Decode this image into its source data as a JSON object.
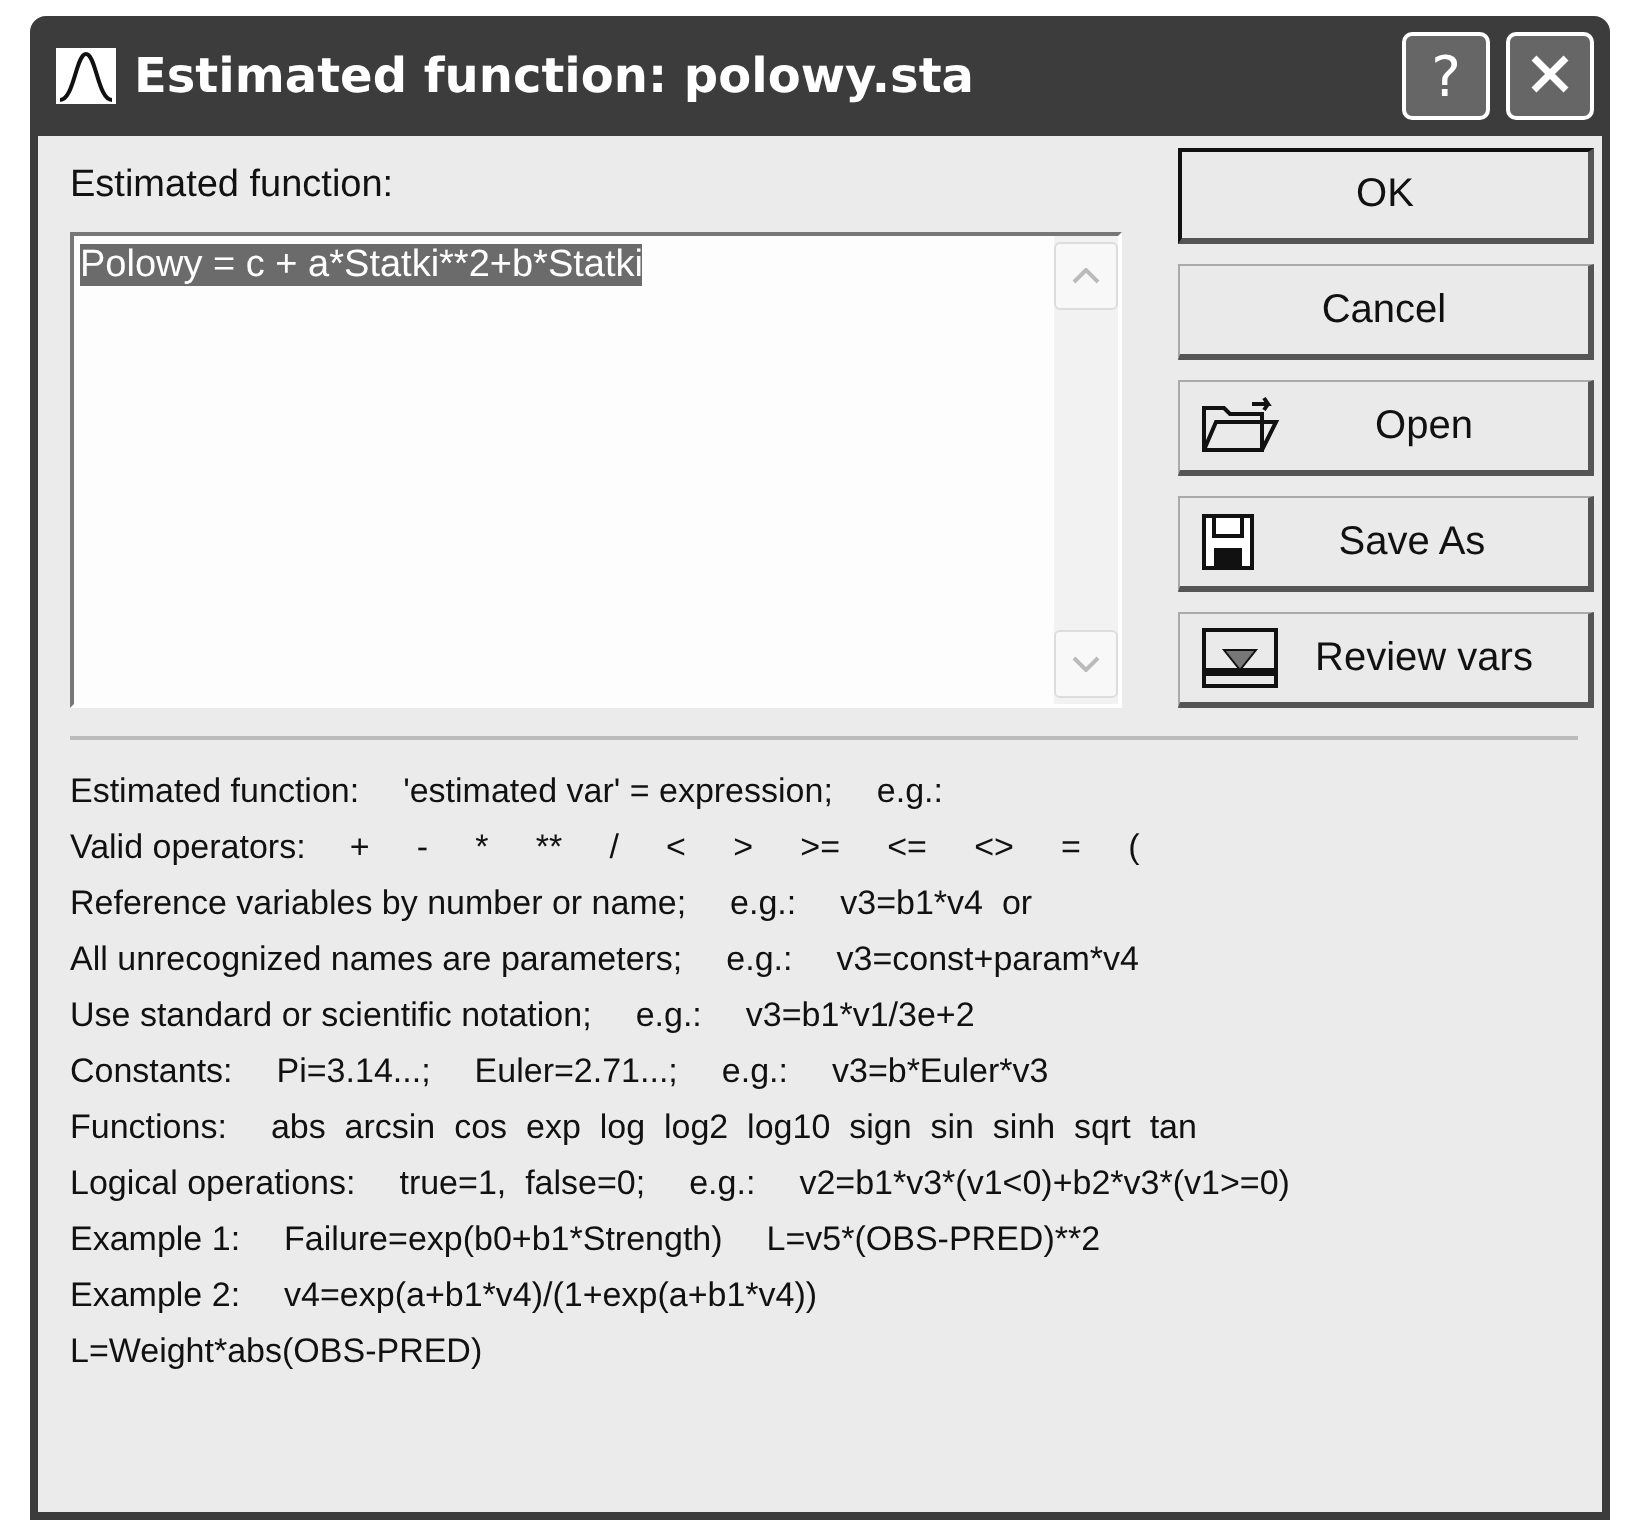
{
  "window": {
    "title": "Estimated function: polowy.sta",
    "title_buttons": [
      {
        "kind": "help",
        "label": "?"
      },
      {
        "kind": "close"
      }
    ]
  },
  "field_label": "Estimated function:",
  "expression": {
    "value": "Polowy = c + a*Statki**2+b*Statki",
    "selected": true
  },
  "buttons": [
    {
      "label": "OK",
      "kind": "plain",
      "default": true
    },
    {
      "label": "Cancel",
      "kind": "plain",
      "default": false
    },
    {
      "label": "Open",
      "kind": "open",
      "default": false
    },
    {
      "label": "Save As",
      "kind": "save",
      "default": false
    },
    {
      "label": "Review vars",
      "kind": "review",
      "default": false
    }
  ],
  "help_lines": [
    [
      "Estimated function:",
      "'estimated var' = expression;",
      "e.g.:"
    ],
    [
      "Valid operators:",
      "+     -     *     **     /     <     >     >=     <=     <>     =     ("
    ],
    [
      "Reference variables by number or name;",
      "e.g.:",
      "v3=b1*v4  or"
    ],
    [
      "All unrecognized names are parameters;",
      "e.g.:",
      "v3=const+param*v4"
    ],
    [
      "Use standard or scientific notation;",
      "e.g.:",
      "v3=b1*v1/3e+2"
    ],
    [
      "Constants:",
      "Pi=3.14...;",
      "Euler=2.71...;",
      "e.g.:",
      "v3=b*Euler*v3"
    ],
    [
      "Functions:",
      "abs  arcsin  cos  exp  log  log2  log10  sign  sin  sinh  sqrt  tan"
    ],
    [
      "Logical operations:",
      "true=1,  false=0;",
      "e.g.:",
      "v2=b1*v3*(v1<0)+b2*v3*(v1>=0)"
    ],
    [
      "Example 1:",
      "Failure=exp(b0+b1*Strength)",
      "L=v5*(OBS-PRED)**2"
    ],
    [
      "Example 2:",
      "v4=exp(a+b1*v4)/(1+exp(a+b1*v4))"
    ],
    [
      "L=Weight*abs(OBS-PRED)"
    ]
  ]
}
